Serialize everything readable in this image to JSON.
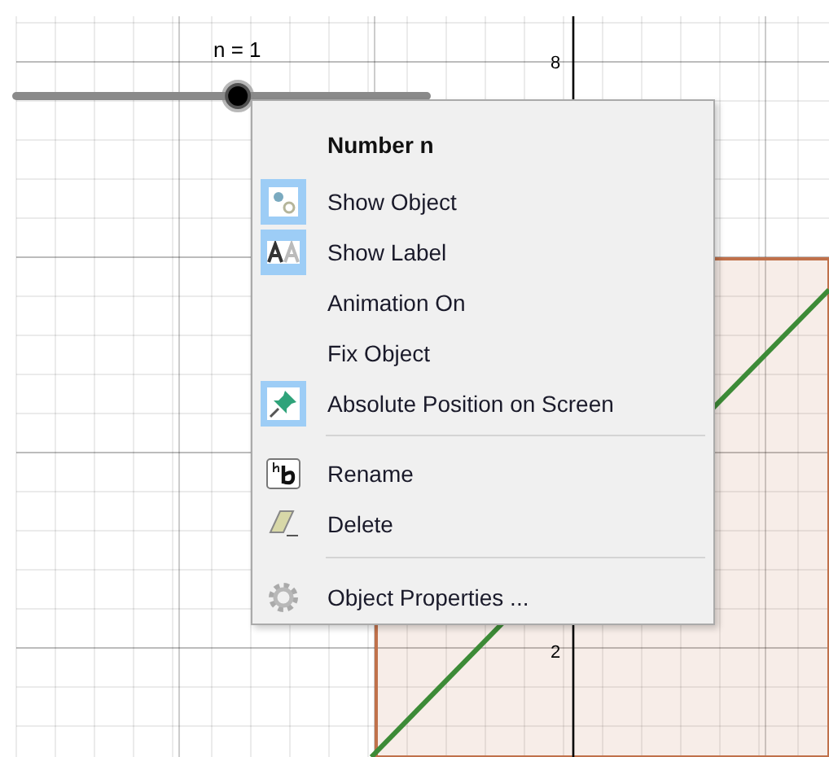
{
  "slider": {
    "label": "n = 1",
    "level": 0.54
  },
  "axis_labels": [
    {
      "text": "8",
      "kind": "top"
    },
    {
      "text": "2",
      "kind": "bottom"
    }
  ],
  "context_menu": {
    "title": "Number n",
    "groups": [
      [
        {
          "label": "Show Object",
          "kind": "visibility",
          "checked": true
        },
        {
          "label": "Show Label",
          "kind": "label",
          "checked": true
        },
        {
          "label": "Animation On",
          "kind": "plain"
        },
        {
          "label": "Fix Object",
          "kind": "plain"
        },
        {
          "label": "Absolute Position on Screen",
          "kind": "pin",
          "checked": true
        }
      ],
      [
        {
          "label": "Rename",
          "kind": "rename"
        },
        {
          "label": "Delete",
          "kind": "eraser"
        }
      ],
      [
        {
          "label": "Object Properties ...",
          "kind": "gear"
        }
      ]
    ]
  }
}
